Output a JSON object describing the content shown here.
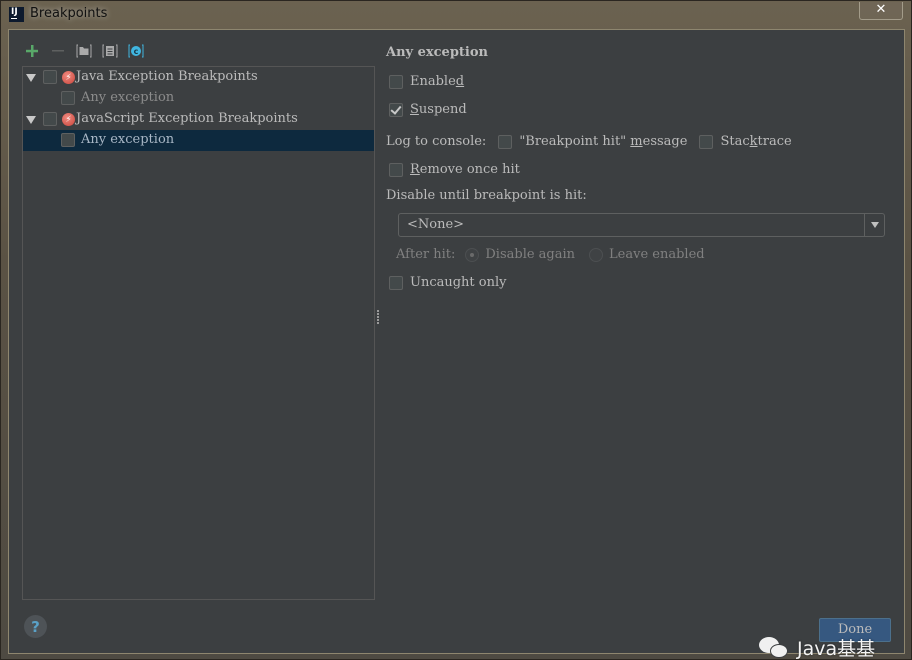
{
  "window": {
    "title": "Breakpoints",
    "app_icon": "IJ",
    "close_label": "✕"
  },
  "toolbar": {
    "items": [
      {
        "name": "add-icon",
        "label": "+"
      },
      {
        "name": "remove-icon",
        "label": "−"
      },
      {
        "name": "group-by-file-icon",
        "label": "folder"
      },
      {
        "name": "group-by-package-icon",
        "label": "package"
      },
      {
        "name": "group-by-class-icon",
        "label": "class"
      }
    ],
    "colors": {
      "add": "#59a869",
      "remove": "#5e6060",
      "class": "#40b6e0"
    }
  },
  "tree": {
    "groups": [
      {
        "label": "Java Exception Breakpoints",
        "expanded": true,
        "checked": false,
        "children": [
          {
            "label": "Any exception",
            "checked": false,
            "selected": false
          }
        ]
      },
      {
        "label": "JavaScript Exception Breakpoints",
        "expanded": true,
        "checked": false,
        "children": [
          {
            "label": "Any exception",
            "checked": false,
            "selected": true
          }
        ]
      }
    ]
  },
  "properties": {
    "title": "Any exception",
    "enabled": {
      "label_pre": "Enable",
      "label_u": "d",
      "label_post": "",
      "checked": false
    },
    "suspend": {
      "label_pre": "",
      "label_u": "S",
      "label_post": "uspend",
      "checked": true
    },
    "log_to_console_label": "Log to console:",
    "breakpoint_hit_message": {
      "label_pre": "\"Breakpoint hit\" ",
      "label_u": "m",
      "label_post": "essage",
      "checked": false
    },
    "stacktrace": {
      "label_pre": "Stac",
      "label_u": "k",
      "label_post": "trace",
      "checked": false
    },
    "remove_once_hit": {
      "label_pre": "",
      "label_u": "R",
      "label_post": "emove once hit",
      "checked": false
    },
    "disable_until_label": "Disable until breakpoint is hit:",
    "disable_until_value": "<None>",
    "after_hit_label": "After hit:",
    "after_hit_options": [
      {
        "label": "Disable again",
        "selected": true
      },
      {
        "label": "Leave enabled",
        "selected": false
      }
    ],
    "uncaught_only": {
      "label": "Uncaught only",
      "checked": false
    }
  },
  "footer": {
    "help_label": "?",
    "done_label": "Done",
    "watermark_text": "Java基基"
  }
}
